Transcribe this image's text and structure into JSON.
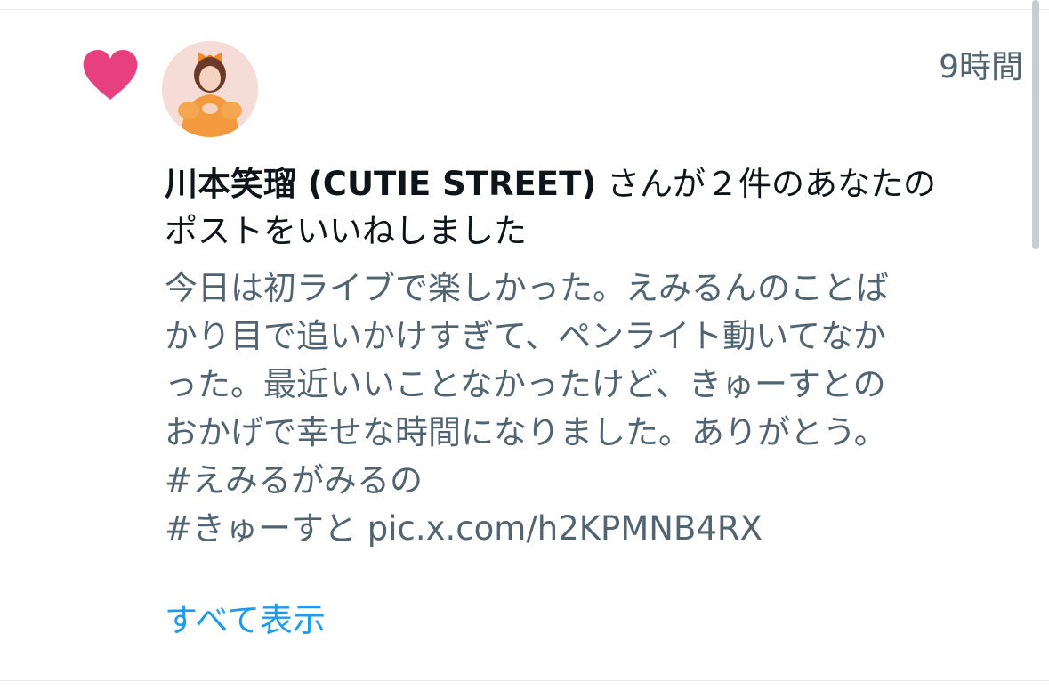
{
  "notification": {
    "icon": "heart-icon",
    "timestamp": "9時間",
    "user_name": "川本笑瑠 (CUTIE STREET)",
    "action_text": " さんが２件のあなたの\nポストをいいねしました",
    "post_text": "今日は初ライブで楽しかった。えみるんのことば\nかり目で追いかけすぎて、ペンライト動いてなか\nった。最近いいことなかったけど、きゅーすとの\nおかげで幸せな時間になりました。ありがとう。\n#えみるがみるの\n#きゅーすと pic.x.com/h2KPMNB4RX",
    "show_all_label": "すべて表示"
  },
  "colors": {
    "heart": "#e8407f",
    "link": "#1d9bf0",
    "muted_text": "#536471",
    "primary_text": "#0f1419"
  }
}
